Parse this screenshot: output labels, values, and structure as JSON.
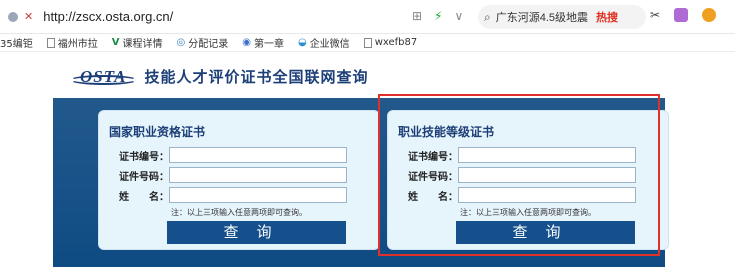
{
  "browser": {
    "url": "http://zscx.osta.org.cn/",
    "search_query": "广东河源4.5级地震",
    "search_hot_label": "热搜",
    "grid_icon": "grid-icon",
    "bolt_icon": "bolt-icon",
    "chevron_icon": "chevron-down-icon"
  },
  "bookmarks": [
    {
      "label": "35编钜"
    },
    {
      "label": "福州市拉"
    },
    {
      "label": "课程详情"
    },
    {
      "label": "分配记录"
    },
    {
      "label": "第一章"
    },
    {
      "label": "企业微信"
    },
    {
      "label": "wxefb87"
    }
  ],
  "site": {
    "logo_text": "OSTA",
    "title": "技能人才评价证书全国联网查询"
  },
  "panels": {
    "left": {
      "title": "国家职业资格证书",
      "fields": [
        {
          "label": "证书编号：",
          "value": ""
        },
        {
          "label": "证件号码：",
          "value": ""
        },
        {
          "label": "姓　　名：",
          "value": ""
        }
      ],
      "note": "注：以上三项输入任意两项即可查询。",
      "button": "查询"
    },
    "right": {
      "title": "职业技能等级证书",
      "fields": [
        {
          "label": "证书编号：",
          "value": ""
        },
        {
          "label": "证件号码：",
          "value": ""
        },
        {
          "label": "姓　　名：",
          "value": ""
        }
      ],
      "note": "注：以上三项输入任意两项即可查询。",
      "button": "查询"
    }
  },
  "colors": {
    "brand": "#1d3f78",
    "banner": "#0f4b83",
    "button": "#15508c",
    "highlight": "#e0302a"
  }
}
